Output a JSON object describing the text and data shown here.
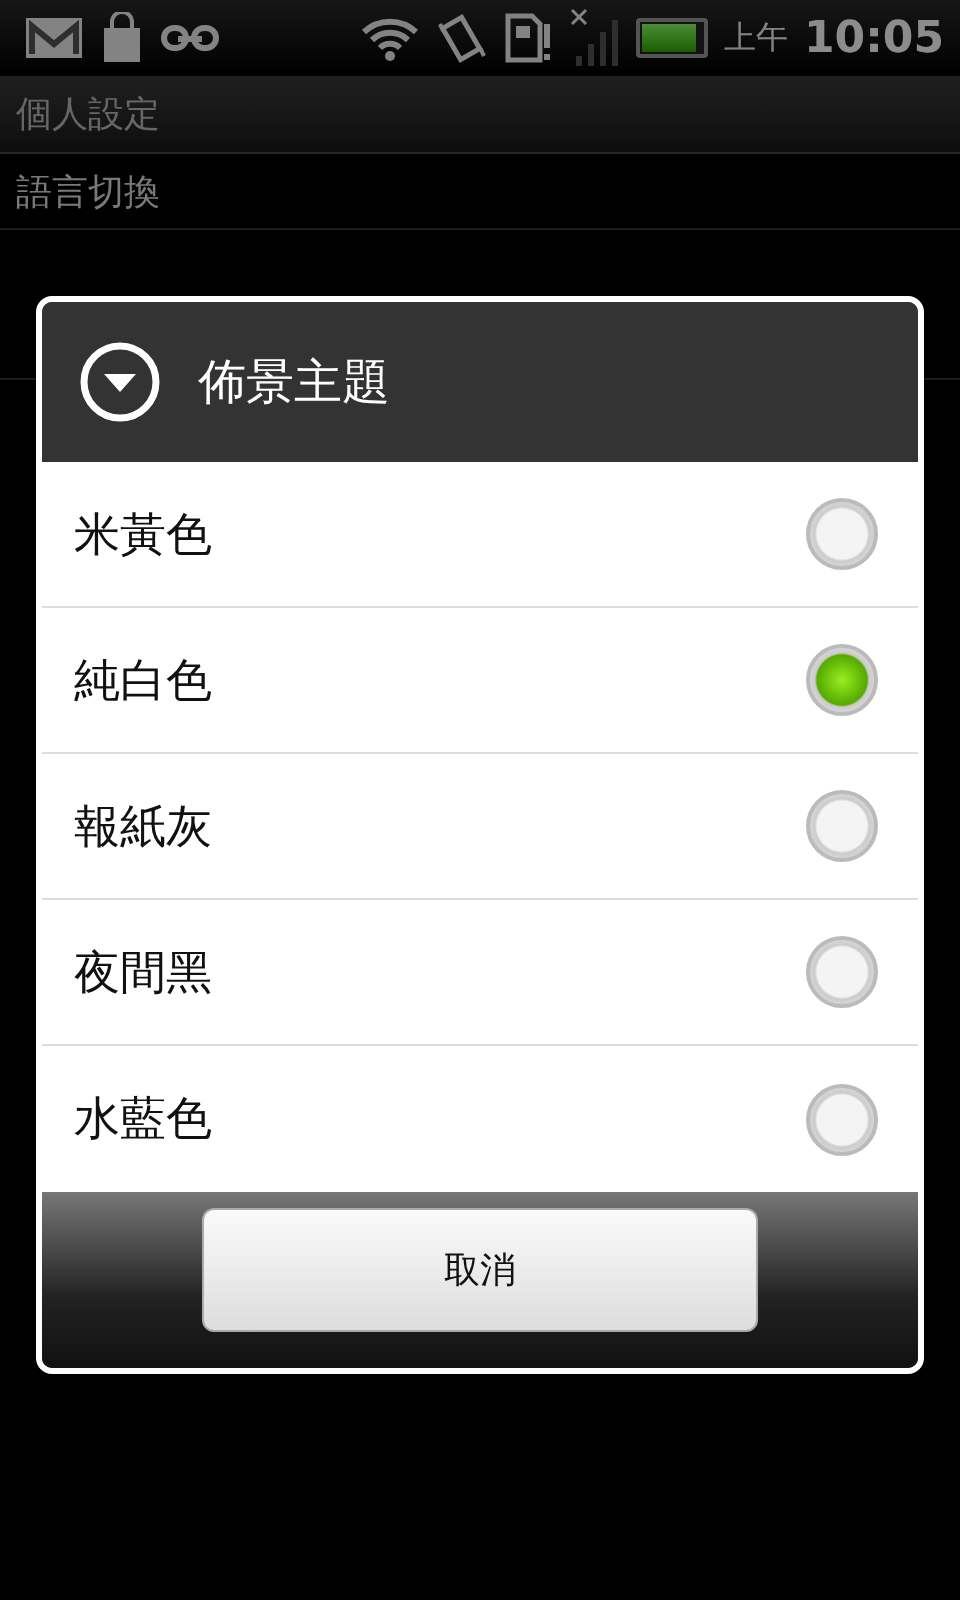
{
  "status_bar": {
    "am_pm": "上午",
    "time": "10:05",
    "battery": {
      "level": 0.9
    }
  },
  "settings": {
    "section_header": "個人設定",
    "items": [
      {
        "label": "語言切換"
      }
    ]
  },
  "dialog": {
    "title": "佈景主題",
    "options": [
      {
        "label": "米黃色",
        "selected": false
      },
      {
        "label": "純白色",
        "selected": true
      },
      {
        "label": "報紙灰",
        "selected": false
      },
      {
        "label": "夜間黑",
        "selected": false
      },
      {
        "label": "水藍色",
        "selected": false
      }
    ],
    "cancel_button": "取消"
  }
}
